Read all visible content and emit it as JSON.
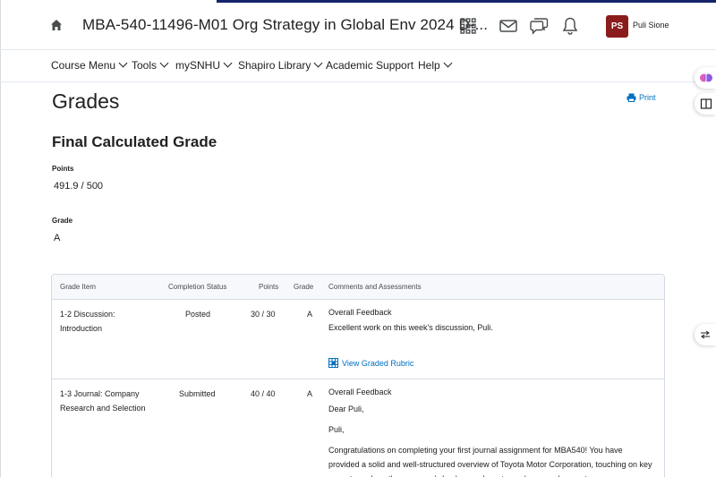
{
  "header": {
    "course_title": "MBA-540-11496-M01 Org Strategy in Global Env 2024 D-...",
    "user_initials": "PS",
    "user_name": "Puli Sione"
  },
  "icons": {
    "home": "home-icon",
    "apps": "waffle-icon",
    "email": "envelope-icon",
    "chat": "chat-bubbles-icon",
    "notifications": "bell-icon",
    "print": "printer-icon",
    "rubric": "rubric-icon"
  },
  "colors": {
    "accent_navy": "#16226a",
    "link": "#006fbf",
    "avatar_bg": "#8b1c1c"
  },
  "nav": {
    "items": [
      {
        "label": "Course Menu",
        "dropdown": true
      },
      {
        "label": "Tools",
        "dropdown": true
      },
      {
        "label": "mySNHU",
        "dropdown": true
      },
      {
        "label": "Shapiro Library",
        "dropdown": true
      },
      {
        "label": "Academic Support",
        "dropdown": false
      },
      {
        "label": "Help",
        "dropdown": true
      }
    ]
  },
  "page": {
    "title": "Grades",
    "print_label": "Print",
    "section_title": "Final Calculated Grade",
    "points_label": "Points",
    "points_value": "491.9 / 500",
    "grade_label": "Grade",
    "grade_value": "A"
  },
  "table": {
    "headers": [
      "Grade Item",
      "Completion Status",
      "Points",
      "Grade",
      "Comments and Assessments"
    ],
    "rows": [
      {
        "item_line1": "1-2 Discussion:",
        "item_line2": "Introduction",
        "status": "Posted",
        "points": "30 / 30",
        "grade": "A",
        "comment_head": "Overall Feedback",
        "comment_text": "Excellent work on this week's discussion, Puli.",
        "rubric_link": "View Graded Rubric"
      },
      {
        "item_line1": "1-3 Journal: Company",
        "item_line2": "Research and Selection",
        "status": "Submitted",
        "points": "40 / 40",
        "grade": "A",
        "comment_head": "Overall Feedback",
        "comment_greeting": "Dear Puli,",
        "comment_name": "Puli,",
        "comment_text": "Congratulations on completing your first journal assignment for MBA540! You have provided a solid and well-structured overview of Toyota Motor Corporation, touching on key aspects such as the company's background, customer base, and current"
      }
    ]
  }
}
